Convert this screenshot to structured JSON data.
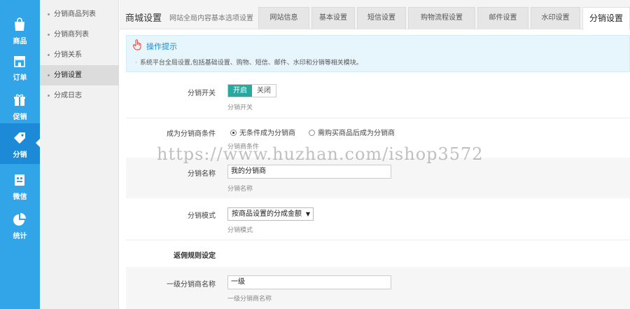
{
  "iconbar": {
    "items": [
      {
        "label": "商品",
        "icon": "shopping-bag-icon"
      },
      {
        "label": "订单",
        "icon": "store-icon"
      },
      {
        "label": "促销",
        "icon": "gift-icon"
      },
      {
        "label": "分销",
        "icon": "tag-icon",
        "active": true
      },
      {
        "label": "微信",
        "icon": "wechat-icon"
      },
      {
        "label": "统计",
        "icon": "pie-chart-icon"
      }
    ]
  },
  "submenu": {
    "items": [
      {
        "label": "分销商品列表"
      },
      {
        "label": "分销商列表"
      },
      {
        "label": "分销关系"
      },
      {
        "label": "分销设置",
        "active": true
      },
      {
        "label": "分成日志"
      }
    ]
  },
  "header": {
    "title": "商城设置",
    "subtitle": "网站全局内容基本选项设置",
    "tabs": [
      {
        "label": "网站信息"
      },
      {
        "label": "基本设置"
      },
      {
        "label": "短信设置"
      },
      {
        "label": "购物流程设置"
      },
      {
        "label": "邮件设置"
      },
      {
        "label": "水印设置"
      },
      {
        "label": "分销设置",
        "active": true
      }
    ]
  },
  "tip": {
    "title": "操作提示",
    "text": "系统平台全局设置,包括基础设置、购物、短信、邮件、水印和分销等相关模块。"
  },
  "form": {
    "switch": {
      "label": "分销开关",
      "on": "开启",
      "off": "关闭",
      "hint": "分销开关"
    },
    "condition": {
      "label": "成为分销商条件",
      "option1": "无条件成为分销商",
      "option2": "需购买商品后成为分销商",
      "hint": "分销商条件"
    },
    "name": {
      "label": "分销名称",
      "value": "我的分销商",
      "hint": "分销名称"
    },
    "mode": {
      "label": "分销模式",
      "value": "按商品设置的分成金额",
      "hint": "分销模式"
    },
    "section": {
      "label": "返佣规则设定"
    },
    "level1": {
      "label": "一级分销商名称",
      "value": "一级",
      "hint": "一级分销商名称"
    }
  },
  "watermark": "https://www.huzhan.com/ishop3572",
  "colors": {
    "iconbar": "#32a4e8",
    "switch_on": "#27a9a0",
    "tip_bg": "#e7f5fd"
  }
}
